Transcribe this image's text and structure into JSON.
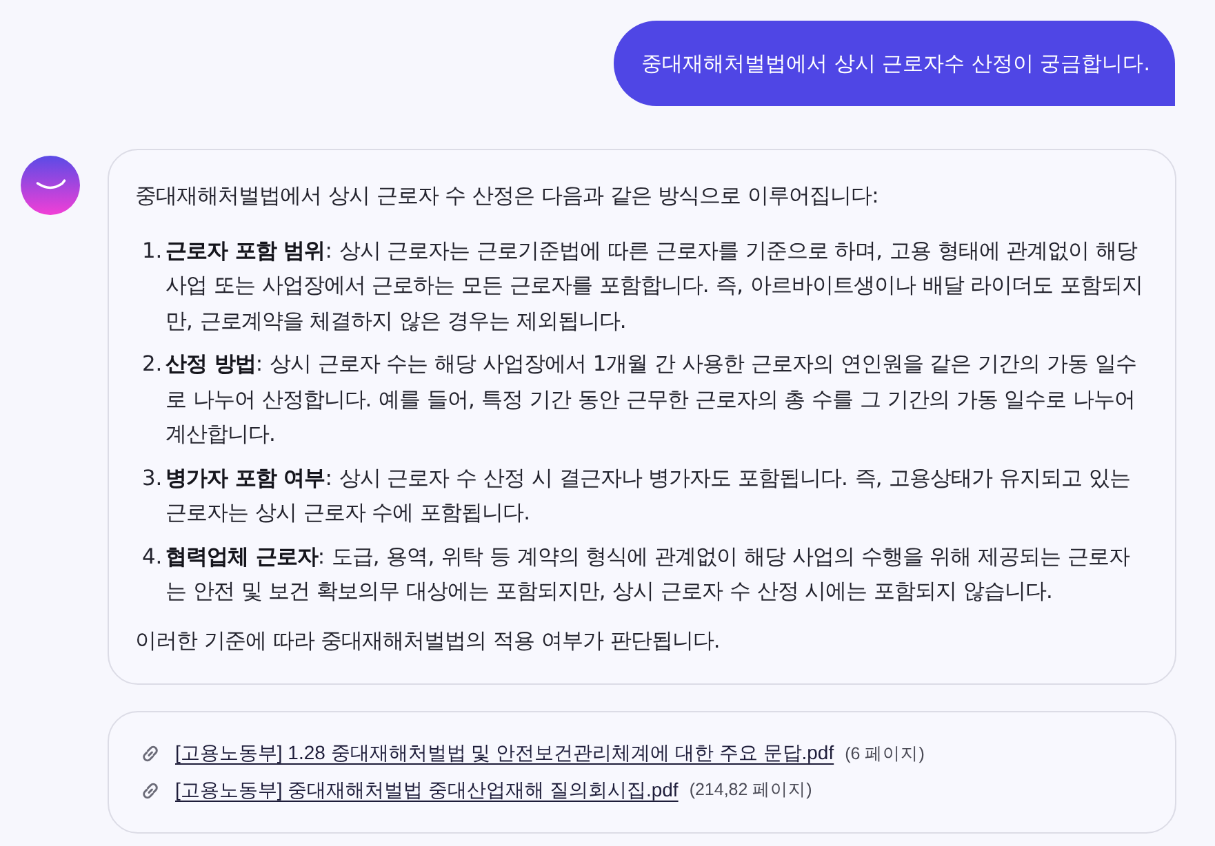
{
  "user_message": {
    "text": "중대재해처벌법에서 상시 근로자수 산정이 궁금합니다."
  },
  "assistant_message": {
    "intro": "중대재해처벌법에서 상시 근로자 수 산정은 다음과 같은 방식으로 이루어집니다:",
    "items": [
      {
        "number": "1.",
        "text": "**근로자 포함 범위**: 상시 근로자는 근로기준법에 따른 근로자를 기준으로 하며, 고용 형태에 관계없이 해당 사업 또는 사업장에서 근로하는 모든 근로자를 포함합니다. 즉, 아르바이트생이나 배달 라이더도 포함되지만, 근로계약을 체결하지 않은 경우는 제외됩니다."
      },
      {
        "number": "2.",
        "text": "**산정 방법**: 상시 근로자 수는 해당 사업장에서 1개월 간 사용한 근로자의 연인원을 같은 기간의 가동 일수로 나누어 산정합니다. 예를 들어, 특정 기간 동안 근무한 근로자의 총 수를 그 기간의 가동 일수로 나누어 계산합니다."
      },
      {
        "number": "3.",
        "text": "**병가자 포함 여부**: 상시 근로자 수 산정 시 결근자나 병가자도 포함됩니다. 즉, 고용상태가 유지되고 있는 근로자는 상시 근로자 수에 포함됩니다."
      },
      {
        "number": "4.",
        "text": "**협력업체 근로자**: 도급, 용역, 위탁 등 계약의 형식에 관계없이 해당 사업의 수행을 위해 제공되는 근로자는 안전 및 보건 확보의무 대상에는 포함되지만, 상시 근로자 수 산정 시에는 포함되지 않습니다."
      }
    ],
    "conclusion": "이러한 기준에 따라 중대재해처벌법의 적용 여부가 판단됩니다."
  },
  "sources": [
    {
      "title": "[고용노동부] 1.28 중대재해처벌법 및 안전보건관리체계에 대한 주요 문답.pdf",
      "pages": "(6 페이지)"
    },
    {
      "title": "[고용노동부] 중대재해처벌법 중대산업재해 질의회시집.pdf",
      "pages": "(214,82 페이지)"
    }
  ]
}
